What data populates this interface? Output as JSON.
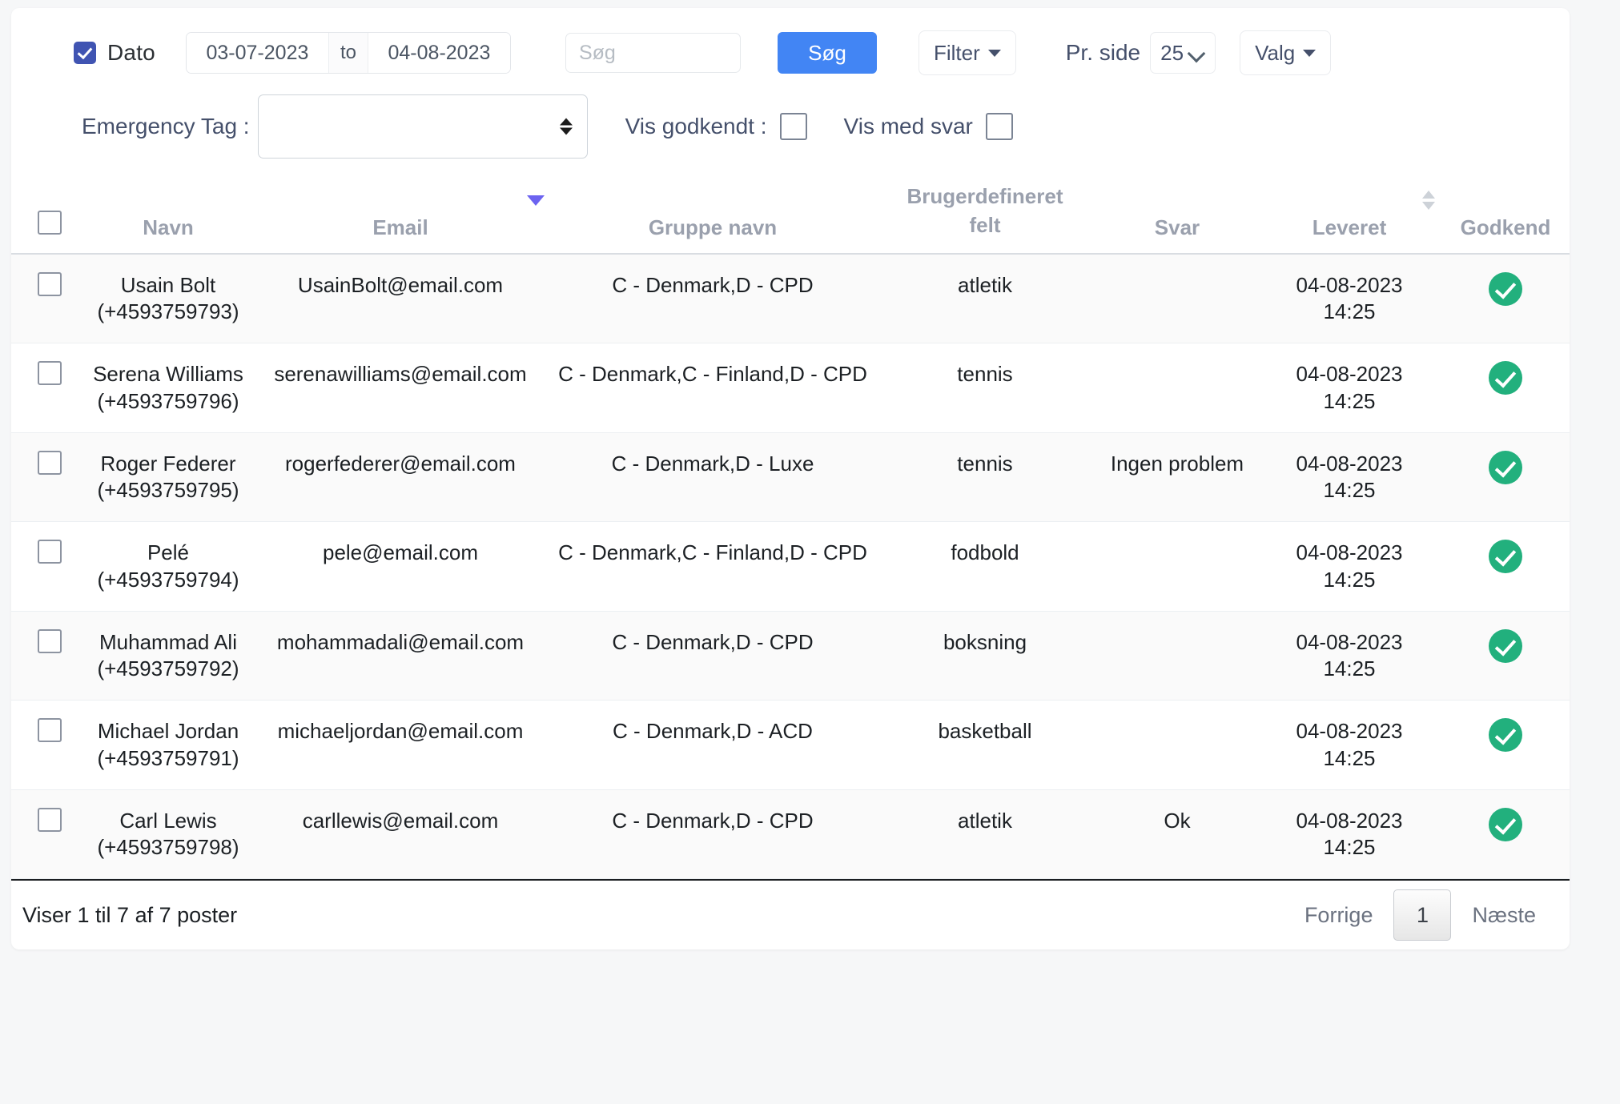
{
  "toolbar": {
    "date_checkbox_label": "Dato",
    "date_from": "03-07-2023",
    "date_to": "04-08-2023",
    "date_separator": "to",
    "search_placeholder": "Søg",
    "search_value": "",
    "search_button": "Søg",
    "filter_button": "Filter",
    "per_page_label": "Pr. side",
    "per_page_value": "25",
    "per_page_options": [
      "25"
    ],
    "options_button": "Valg",
    "emergency_tag_label": "Emergency Tag :",
    "emergency_tag_value": "",
    "show_approved_label": "Vis godkendt :",
    "show_with_answer_label": "Vis med svar",
    "primary_color": "#4285f4",
    "checkbox_color": "#4054b2"
  },
  "table": {
    "columns": [
      {
        "key": "select",
        "label": ""
      },
      {
        "key": "navn",
        "label": "Navn"
      },
      {
        "key": "email",
        "label": "Email"
      },
      {
        "key": "gruppe",
        "label": "Gruppe navn"
      },
      {
        "key": "bdf_l1",
        "label": "Brugerdefineret"
      },
      {
        "key": "bdf_l2",
        "label": "felt"
      },
      {
        "key": "svar",
        "label": "Svar"
      },
      {
        "key": "leveret",
        "label": "Leveret"
      },
      {
        "key": "godkend",
        "label": "Godkend"
      }
    ],
    "sort": {
      "email": "desc",
      "leveret": "none"
    },
    "approved_color": "#22b07d",
    "rows": [
      {
        "name": "Usain Bolt",
        "phone": "(+4593759793)",
        "email": "UsainBolt@email.com",
        "group": "C - Denmark,D - CPD",
        "custom_field": "atletik",
        "answer": "",
        "delivered_date": "04-08-2023",
        "delivered_time": "14:25",
        "approved": true
      },
      {
        "name": "Serena Williams",
        "phone": "(+4593759796)",
        "email": "serenawilliams@email.com",
        "group": "C - Denmark,C - Finland,D - CPD",
        "custom_field": "tennis",
        "answer": "",
        "delivered_date": "04-08-2023",
        "delivered_time": "14:25",
        "approved": true
      },
      {
        "name": "Roger Federer",
        "phone": "(+4593759795)",
        "email": "rogerfederer@email.com",
        "group": "C - Denmark,D - Luxe",
        "custom_field": "tennis",
        "answer": "Ingen problem",
        "delivered_date": "04-08-2023",
        "delivered_time": "14:25",
        "approved": true
      },
      {
        "name": "Pelé",
        "phone": "(+4593759794)",
        "email": "pele@email.com",
        "group": "C - Denmark,C - Finland,D - CPD",
        "custom_field": "fodbold",
        "answer": "",
        "delivered_date": "04-08-2023",
        "delivered_time": "14:25",
        "approved": true
      },
      {
        "name": "Muhammad Ali",
        "phone": "(+4593759792)",
        "email": "mohammadali@email.com",
        "group": "C - Denmark,D - CPD",
        "custom_field": "boksning",
        "answer": "",
        "delivered_date": "04-08-2023",
        "delivered_time": "14:25",
        "approved": true
      },
      {
        "name": "Michael Jordan",
        "phone": "(+4593759791)",
        "email": "michaeljordan@email.com",
        "group": "C - Denmark,D - ACD",
        "custom_field": "basketball",
        "answer": "",
        "delivered_date": "04-08-2023",
        "delivered_time": "14:25",
        "approved": true
      },
      {
        "name": "Carl Lewis",
        "phone": "(+4593759798)",
        "email": "carllewis@email.com",
        "group": "C - Denmark,D - CPD",
        "custom_field": "atletik",
        "answer": "Ok",
        "delivered_date": "04-08-2023",
        "delivered_time": "14:25",
        "approved": true
      }
    ]
  },
  "footer": {
    "info": "Viser 1 til 7 af 7 poster",
    "previous": "Forrige",
    "current_page": "1",
    "next": "Næste"
  }
}
